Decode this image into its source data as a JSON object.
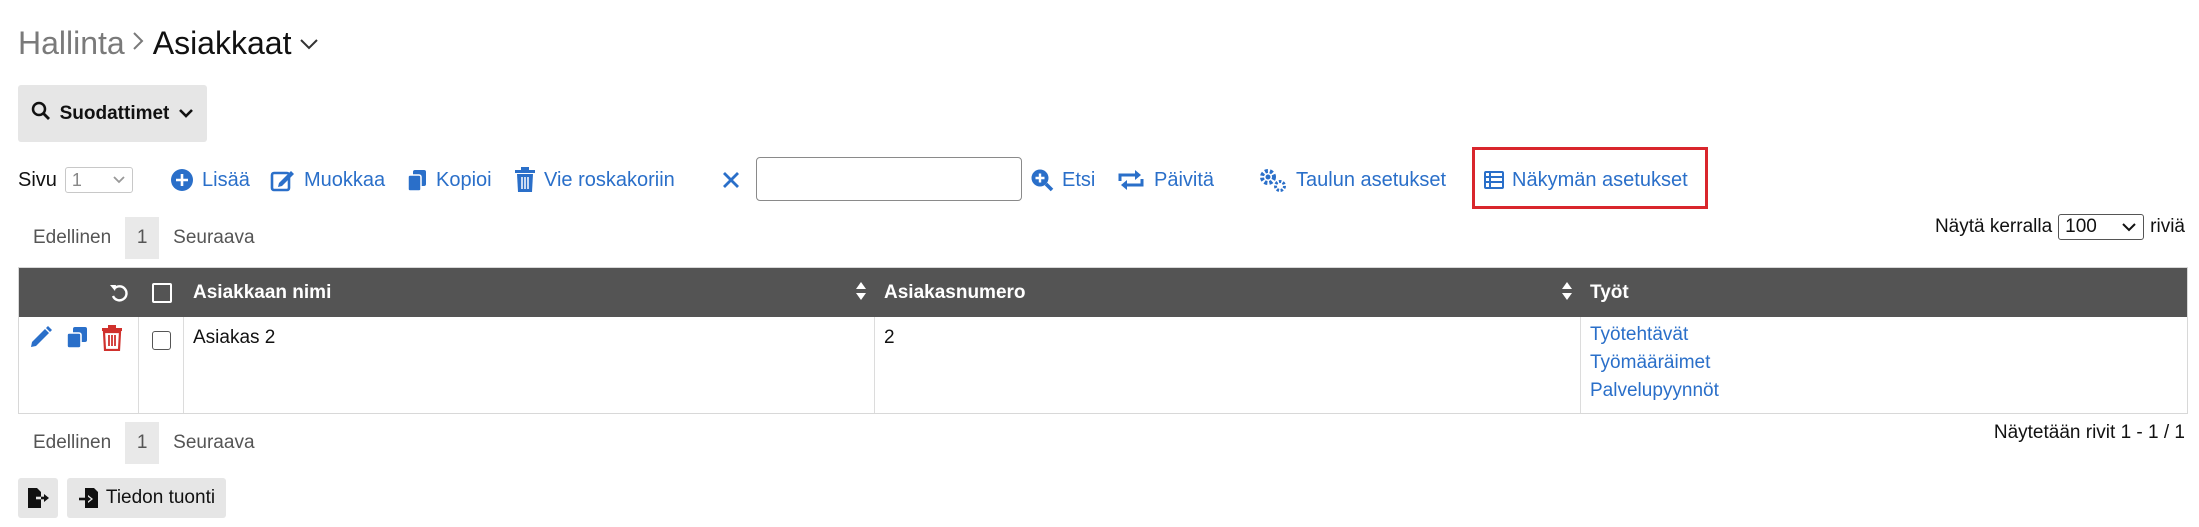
{
  "breadcrumb": {
    "root": "Hallinta",
    "current": "Asiakkaat"
  },
  "filters": {
    "label": "Suodattimet"
  },
  "toolbar": {
    "page_label": "Sivu",
    "page_value": "1",
    "add": "Lisää",
    "edit": "Muokkaa",
    "copy": "Kopioi",
    "trash": "Vie roskakoriin",
    "search_value": "",
    "search": "Etsi",
    "refresh": "Päivitä",
    "table_settings": "Taulun asetukset",
    "view_settings": "Näkymän asetukset"
  },
  "pagination": {
    "prev": "Edellinen",
    "current": "1",
    "next": "Seuraava"
  },
  "per_page": {
    "prefix": "Näytä kerralla",
    "value": "100",
    "suffix": "riviä"
  },
  "table": {
    "columns": [
      "Asiakkaan nimi",
      "Asiakasnumero",
      "Työt"
    ],
    "rows": [
      {
        "name": "Asiakas 2",
        "number": "2",
        "links": [
          "Työtehtävät",
          "Työmääräimet",
          "Palvelupyynnöt"
        ]
      }
    ]
  },
  "status": "Näytetään rivit 1 - 1 / 1",
  "import": {
    "label": "Tiedon tuonti"
  },
  "colors": {
    "accent": "#2a6fc9",
    "header_bg": "#545454",
    "highlight": "#d9262c",
    "delete": "#d0312d"
  },
  "icons": [
    "search-icon",
    "chevron-down-icon",
    "plus-circle-icon",
    "edit-icon",
    "copy-icon",
    "trash-icon",
    "close-icon",
    "zoom-icon",
    "refresh-icon",
    "gears-icon",
    "list-icon",
    "undo-icon",
    "sort-icon",
    "pencil-icon",
    "export-icon",
    "import-icon"
  ]
}
